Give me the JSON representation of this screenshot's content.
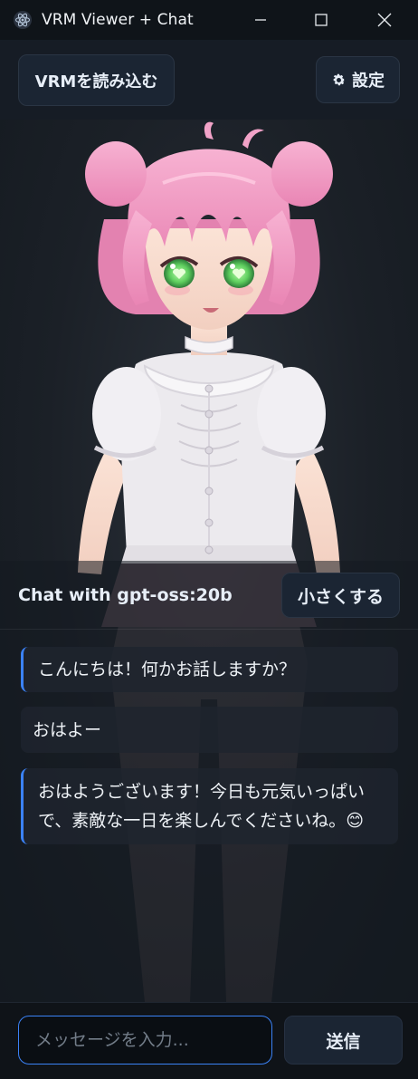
{
  "window": {
    "title": "VRM Viewer + Chat",
    "controls": {
      "minimize": "minimize-icon",
      "maximize": "maximize-icon",
      "close": "close-icon"
    }
  },
  "toolbar": {
    "load_vrm_label": "VRMを読み込む",
    "settings_label": "設定",
    "settings_icon": "gear-icon"
  },
  "chat": {
    "title": "Chat with gpt-oss:20b",
    "minimize_label": "小さくする",
    "messages": [
      {
        "role": "assistant",
        "text": "こんにちは！何かお話しますか？"
      },
      {
        "role": "user",
        "text": "おはよー"
      },
      {
        "role": "assistant",
        "text": "おはようございます！今日も元気いっぱいで、素敵な一日を楽しんでくださいね。😊"
      }
    ],
    "input_placeholder": "メッセージを入力...",
    "send_label": "送信"
  },
  "colors": {
    "accent": "#3b82f6",
    "background": "#0d1117",
    "button_bg": "#1b2533",
    "hair_pink": "#f29ac3",
    "eye_green": "#66d16b"
  }
}
